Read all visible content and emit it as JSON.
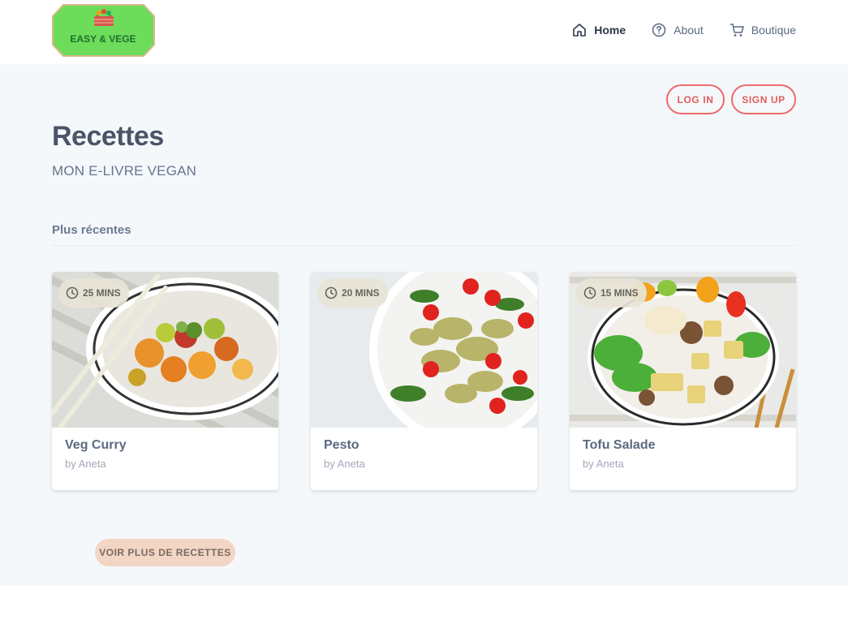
{
  "header": {
    "logo_text": "EASY & VEGE",
    "nav": [
      {
        "label": "Home",
        "icon": "home-icon",
        "active": true
      },
      {
        "label": "About",
        "icon": "help-circle-icon",
        "active": false
      },
      {
        "label": "Boutique",
        "icon": "cart-icon",
        "active": false
      }
    ]
  },
  "auth": {
    "login_label": "LOG IN",
    "signup_label": "SIGN UP"
  },
  "page": {
    "title": "Recettes",
    "subtitle": "MON E-LIVRE VEGAN"
  },
  "section": {
    "title": "Plus récentes"
  },
  "recipes": [
    {
      "time": "25 MINS",
      "title": "Veg Curry",
      "by": "by",
      "author": "Aneta",
      "image": "veg-curry-bowl"
    },
    {
      "time": "20 MINS",
      "title": "Pesto",
      "by": "by",
      "author": "Aneta",
      "image": "pesto-pasta-plate"
    },
    {
      "time": "15 MINS",
      "title": "Tofu Salade",
      "by": "by",
      "author": "Aneta",
      "image": "tofu-salad-bowl"
    }
  ],
  "more_button": {
    "label": "VOIR PLUS DE RECETTES"
  },
  "colors": {
    "accent": "#ef6b6b",
    "background": "#f5f8fb",
    "logo_green": "#6ddc5a",
    "more_button_bg": "#f3d5c4"
  }
}
